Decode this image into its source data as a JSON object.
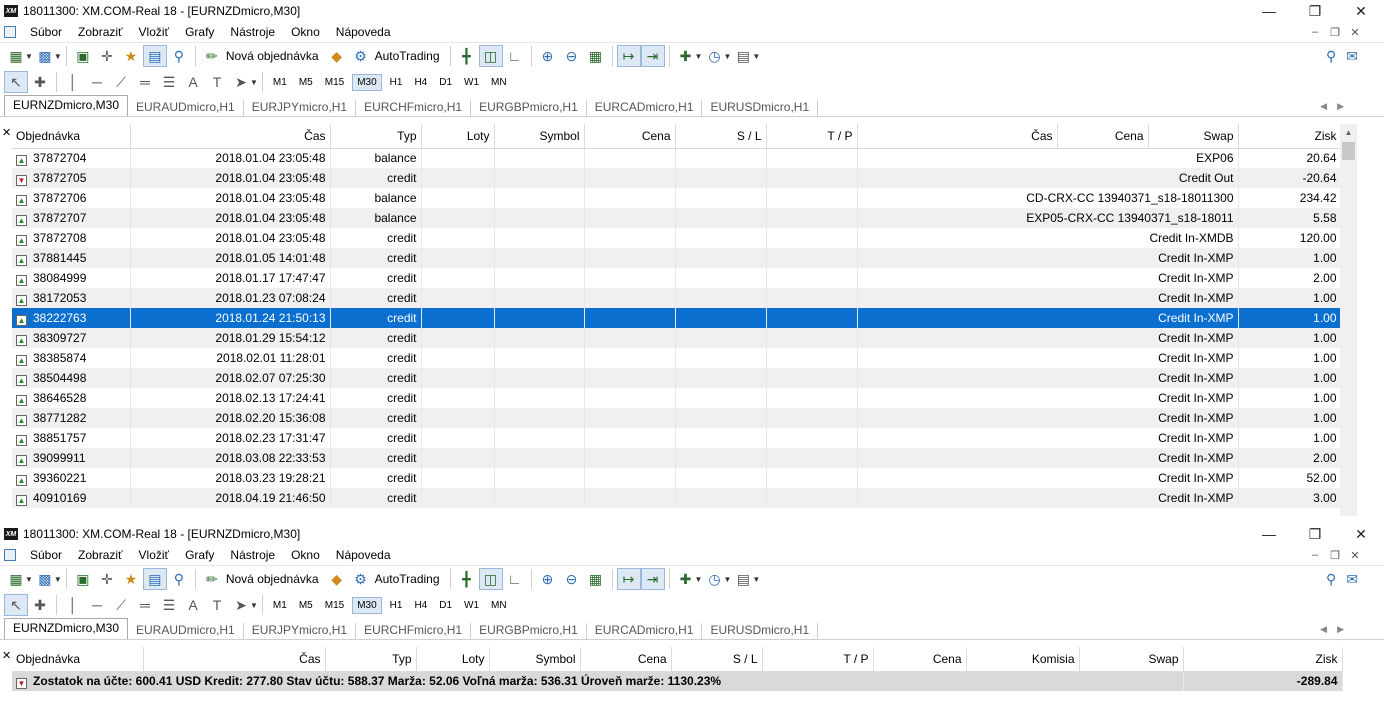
{
  "window1": {
    "title": "18011300: XM.COM-Real 18 - [EURNZDmicro,M30]",
    "menu": [
      "Súbor",
      "Zobraziť",
      "Vložiť",
      "Grafy",
      "Nástroje",
      "Okno",
      "Nápoveda"
    ],
    "toolbar": {
      "new_order_label": "Nová objednávka",
      "autotrading_label": "AutoTrading"
    },
    "timeframes": [
      "M1",
      "M5",
      "M15",
      "M30",
      "H1",
      "H4",
      "D1",
      "W1",
      "MN"
    ],
    "active_timeframe": "M30",
    "tabs": [
      "EURNZDmicro,M30",
      "EURAUDmicro,H1",
      "EURJPYmicro,H1",
      "EURCHFmicro,H1",
      "EURGBPmicro,H1",
      "EURCADmicro,H1",
      "EURUSDmicro,H1"
    ],
    "columns": [
      "Objednávka",
      "Čas",
      "Typ",
      "Loty",
      "Symbol",
      "Cena",
      "S / L",
      "T / P",
      "Čas",
      "Cena",
      "Swap",
      "Zisk"
    ],
    "rows": [
      {
        "order": "37872704",
        "time": "2018.01.04 23:05:48",
        "type": "balance",
        "comment": "EXP06",
        "profit": "20.64",
        "dir": "up"
      },
      {
        "order": "37872705",
        "time": "2018.01.04 23:05:48",
        "type": "credit",
        "comment": "Credit Out",
        "profit": "-20.64",
        "dir": "down"
      },
      {
        "order": "37872706",
        "time": "2018.01.04 23:05:48",
        "type": "balance",
        "comment": "CD-CRX-CC 13940371_s18-18011300",
        "profit": "234.42",
        "dir": "up"
      },
      {
        "order": "37872707",
        "time": "2018.01.04 23:05:48",
        "type": "balance",
        "comment": "EXP05-CRX-CC 13940371_s18-18011",
        "profit": "5.58",
        "dir": "up"
      },
      {
        "order": "37872708",
        "time": "2018.01.04 23:05:48",
        "type": "credit",
        "comment": "Credit In-XMDB",
        "profit": "120.00",
        "dir": "up"
      },
      {
        "order": "37881445",
        "time": "2018.01.05 14:01:48",
        "type": "credit",
        "comment": "Credit In-XMP",
        "profit": "1.00",
        "dir": "up"
      },
      {
        "order": "38084999",
        "time": "2018.01.17 17:47:47",
        "type": "credit",
        "comment": "Credit In-XMP",
        "profit": "2.00",
        "dir": "up"
      },
      {
        "order": "38172053",
        "time": "2018.01.23 07:08:24",
        "type": "credit",
        "comment": "Credit In-XMP",
        "profit": "1.00",
        "dir": "up"
      },
      {
        "order": "38222763",
        "time": "2018.01.24 21:50:13",
        "type": "credit",
        "comment": "Credit In-XMP",
        "profit": "1.00",
        "dir": "up",
        "selected": true
      },
      {
        "order": "38309727",
        "time": "2018.01.29 15:54:12",
        "type": "credit",
        "comment": "Credit In-XMP",
        "profit": "1.00",
        "dir": "up"
      },
      {
        "order": "38385874",
        "time": "2018.02.01 11:28:01",
        "type": "credit",
        "comment": "Credit In-XMP",
        "profit": "1.00",
        "dir": "up"
      },
      {
        "order": "38504498",
        "time": "2018.02.07 07:25:30",
        "type": "credit",
        "comment": "Credit In-XMP",
        "profit": "1.00",
        "dir": "up"
      },
      {
        "order": "38646528",
        "time": "2018.02.13 17:24:41",
        "type": "credit",
        "comment": "Credit In-XMP",
        "profit": "1.00",
        "dir": "up"
      },
      {
        "order": "38771282",
        "time": "2018.02.20 15:36:08",
        "type": "credit",
        "comment": "Credit In-XMP",
        "profit": "1.00",
        "dir": "up"
      },
      {
        "order": "38851757",
        "time": "2018.02.23 17:31:47",
        "type": "credit",
        "comment": "Credit In-XMP",
        "profit": "1.00",
        "dir": "up"
      },
      {
        "order": "39099911",
        "time": "2018.03.08 22:33:53",
        "type": "credit",
        "comment": "Credit In-XMP",
        "profit": "2.00",
        "dir": "up"
      },
      {
        "order": "39360221",
        "time": "2018.03.23 19:28:21",
        "type": "credit",
        "comment": "Credit In-XMP",
        "profit": "52.00",
        "dir": "up"
      },
      {
        "order": "40910169",
        "time": "2018.04.19 21:46:50",
        "type": "credit",
        "comment": "Credit In-XMP",
        "profit": "3.00",
        "dir": "up"
      }
    ]
  },
  "window2": {
    "title": "18011300: XM.COM-Real 18 - [EURNZDmicro,M30]",
    "menu": [
      "Súbor",
      "Zobraziť",
      "Vložiť",
      "Grafy",
      "Nástroje",
      "Okno",
      "Nápoveda"
    ],
    "toolbar": {
      "new_order_label": "Nová objednávka",
      "autotrading_label": "AutoTrading"
    },
    "timeframes": [
      "M1",
      "M5",
      "M15",
      "M30",
      "H1",
      "H4",
      "D1",
      "W1",
      "MN"
    ],
    "tabs": [
      "EURNZDmicro,M30",
      "EURAUDmicro,H1",
      "EURJPYmicro,H1",
      "EURCHFmicro,H1",
      "EURGBPmicro,H1",
      "EURCADmicro,H1",
      "EURUSDmicro,H1"
    ],
    "columns": [
      "Objednávka",
      "Čas",
      "Typ",
      "Loty",
      "Symbol",
      "Cena",
      "S / L",
      "T / P",
      "Cena",
      "Komisia",
      "Swap",
      "Zisk"
    ],
    "summary": "Zostatok na účte: 600.41 USD  Kredit: 277.80  Stav účtu: 588.37  Marža: 52.06  Voľná marža: 536.31  Úroveň marže: 1130.23%",
    "summary_profit": "-289.84"
  }
}
